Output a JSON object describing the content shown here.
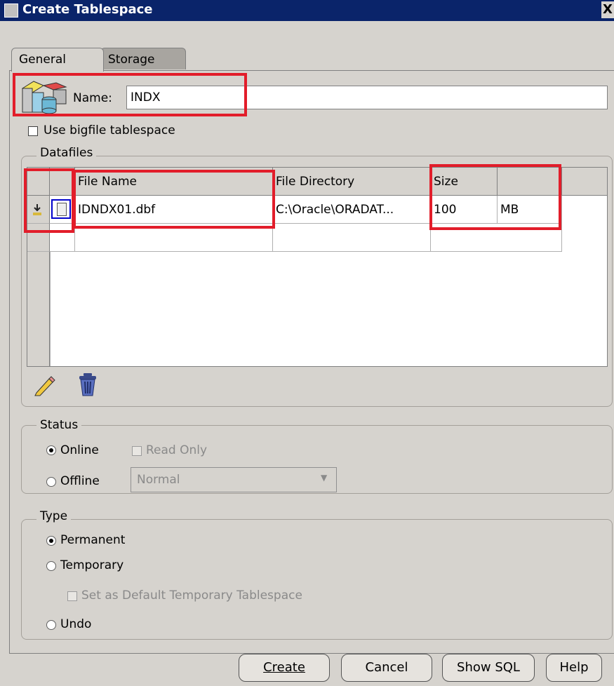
{
  "window": {
    "title": "Create Tablespace",
    "close_glyph": "X"
  },
  "tabs": [
    {
      "label": "General"
    },
    {
      "label": "Storage"
    }
  ],
  "name": {
    "label": "Name:",
    "value": "INDX"
  },
  "bigfile": {
    "label": "Use bigfile tablespace",
    "checked": false
  },
  "datafiles": {
    "legend": "Datafiles",
    "columns": [
      "File Name",
      "File Directory",
      "Size"
    ],
    "rows": [
      {
        "file_name": "IDNDX01.dbf",
        "directory": "C:\\Oracle\\ORADAT...",
        "size": "100",
        "unit": "MB"
      }
    ],
    "edit_icon": "pencil-icon",
    "delete_icon": "trash-icon"
  },
  "status": {
    "legend": "Status",
    "online_label": "Online",
    "offline_label": "Offline",
    "read_only_label": "Read Only",
    "offline_mode": "Normal",
    "selected": "Online"
  },
  "type": {
    "legend": "Type",
    "permanent_label": "Permanent",
    "temporary_label": "Temporary",
    "default_temp_label": "Set as Default Temporary Tablespace",
    "undo_label": "Undo",
    "selected": "Permanent"
  },
  "buttons": {
    "create": "Create",
    "cancel": "Cancel",
    "show_sql": "Show SQL",
    "help": "Help"
  },
  "colors": {
    "highlight": "#e21d2a",
    "titlebar": "#0a246a"
  }
}
